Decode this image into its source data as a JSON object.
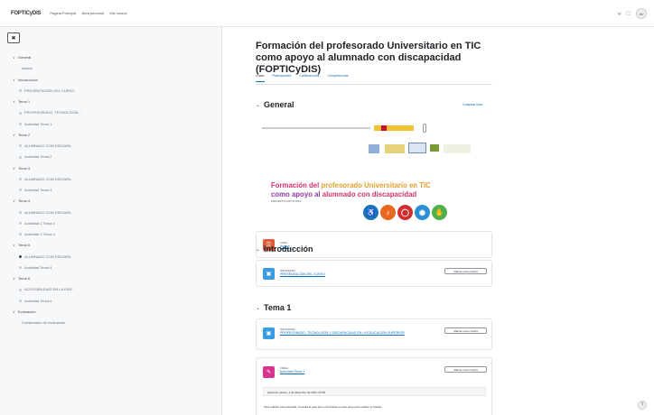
{
  "topbar": {
    "brand": "FOPTICyDIS",
    "nav": [
      "Página Principal",
      "Área personal",
      "Mis cursos"
    ],
    "icons": [
      "bell-icon",
      "chat-icon"
    ],
    "avatar": "AV"
  },
  "drawer": {
    "items": [
      {
        "label": "General",
        "kind": "section",
        "expanded": true
      },
      {
        "label": "Avisos",
        "kind": "indent"
      },
      {
        "label": "Introducción",
        "kind": "section",
        "expanded": true
      },
      {
        "label": "PRESENTACIÓN DEL CURSO",
        "kind": "activity",
        "done": false
      },
      {
        "label": "Tema 1",
        "kind": "section",
        "expanded": true
      },
      {
        "label": "PROFESORADO, TECNOLOGÍA...",
        "kind": "activity",
        "done": false
      },
      {
        "label": "Actividad Tema 1",
        "kind": "activity",
        "done": false
      },
      {
        "label": "Tema 2",
        "kind": "section",
        "expanded": true
      },
      {
        "label": "ALUMNADO CON DISCAPA...",
        "kind": "activity",
        "done": false
      },
      {
        "label": "Actividad Tema 2",
        "kind": "activity",
        "done": false
      },
      {
        "label": "Tema 3",
        "kind": "section",
        "expanded": true
      },
      {
        "label": "ALUMNADO CON DISCAPA...",
        "kind": "activity",
        "done": false
      },
      {
        "label": "Actividad Tema 3",
        "kind": "activity",
        "done": false
      },
      {
        "label": "Tema 4",
        "kind": "section",
        "expanded": true
      },
      {
        "label": "ALUMNADO CON DISCAPA...",
        "kind": "activity",
        "done": false
      },
      {
        "label": "Actividad 1 Tema 4",
        "kind": "activity",
        "done": false
      },
      {
        "label": "Actividad 2 Tema 4",
        "kind": "activity",
        "done": false
      },
      {
        "label": "Tema 5",
        "kind": "section",
        "expanded": true
      },
      {
        "label": "ALUMNADO CON DISCAPA...",
        "kind": "activity",
        "done": true
      },
      {
        "label": "Actividad Tema 5",
        "kind": "activity",
        "done": false
      },
      {
        "label": "Tema 6",
        "kind": "section",
        "expanded": true
      },
      {
        "label": "ACCESIBILIDAD EN LA ENS...",
        "kind": "activity",
        "done": false
      },
      {
        "label": "Actividad Tema 6",
        "kind": "activity",
        "done": false
      },
      {
        "label": "Evaluación",
        "kind": "section",
        "expanded": true
      },
      {
        "label": "Cuestionario de evaluación",
        "kind": "indent"
      }
    ]
  },
  "course": {
    "title": "Formación del profesorado Universitario en TIC como apoyo al alumnado con discapacidad (FOPTICyDIS)",
    "tabs": [
      "Curso",
      "Participantes",
      "Calificaciones",
      "Competencias"
    ],
    "collapse_all": "Colapsar todo"
  },
  "banner": {
    "line1_a": "Formación del",
    "line1_b": "profesorado Universitario en TIC",
    "line2_a": "como apoyo al",
    "line2_b": "alumnado con discapacidad",
    "sub": "PROYECTO FOPTICYDIS",
    "accessibility_icons": [
      "wheelchair-icon",
      "hearing-icon",
      "blind-icon",
      "cognitive-icon",
      "sign-language-icon"
    ],
    "colors": [
      "#1a73b8",
      "#e86a21",
      "#d12f2f",
      "#2b8fd1",
      "#4fb04a"
    ]
  },
  "sections": {
    "general": "General",
    "intro": "Introducción",
    "tema1": "Tema 1"
  },
  "activities": {
    "avisos": {
      "type": "Foro",
      "name": "Avisos"
    },
    "presentacion": {
      "type": "Infografía",
      "name": "PRESENTACIÓN DEL CURSO",
      "button": "Marcar como hecha"
    },
    "profesorado": {
      "type": "Infografía",
      "name": "PROFESORADO, TECNOLOGÍA Y DISCAPACIDAD EN LA EDUCACIÓN SUPERIOR",
      "button": "Marcar como hecha"
    },
    "actividad1": {
      "type": "Tarea",
      "name": "Actividad Tema 1",
      "button": "Marcar como hecha",
      "available": "Apertura: jueves, 1 de diciembre de 2022, 00:00",
      "desc": "Para realizar esta actividad, consulta la guía que encontrarás en este tema para realizar el trabajo."
    }
  }
}
